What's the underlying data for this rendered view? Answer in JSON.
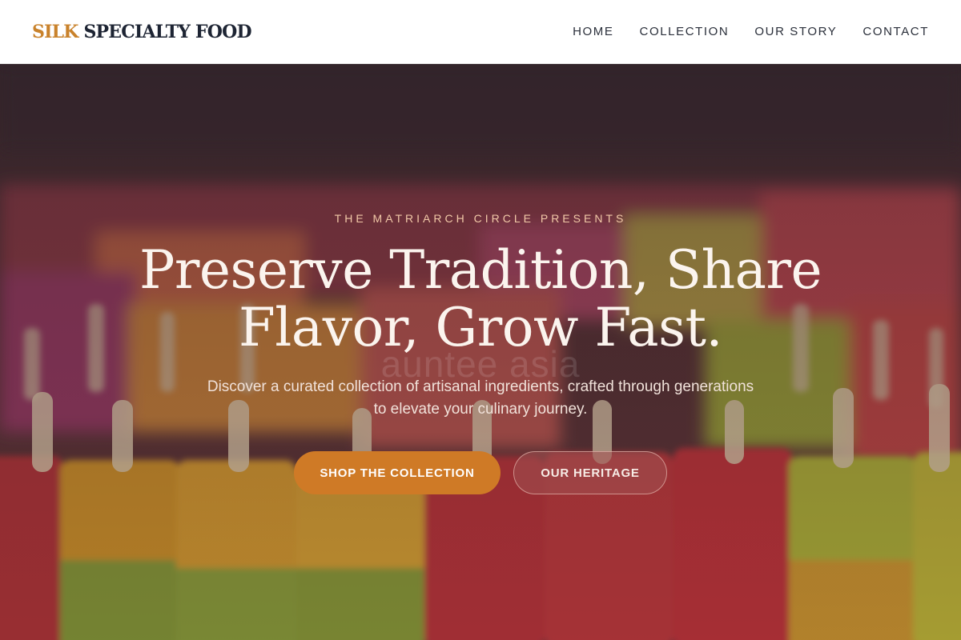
{
  "brand": {
    "part1": "SILK",
    "part2": "SPECIALTY FOOD"
  },
  "nav": {
    "items": [
      {
        "label": "HOME"
      },
      {
        "label": "COLLECTION"
      },
      {
        "label": "OUR STORY"
      },
      {
        "label": "CONTACT"
      }
    ]
  },
  "hero": {
    "eyebrow": "THE MATRIARCH CIRCLE PRESENTS",
    "headline_line1": "Preserve Tradition, Share",
    "headline_line2": "Flavor, Grow Fast.",
    "subtext": "Discover a curated collection of artisanal ingredients, crafted through generations to elevate your culinary journey.",
    "primary_button": "SHOP THE COLLECTION",
    "secondary_button": "OUR HERITAGE",
    "watermark": "auntee asia"
  },
  "colors": {
    "accent": "#cf7a26",
    "logo_gold": "#c9822b",
    "logo_dark": "#1d2433",
    "nav_text": "#2a2f3a"
  }
}
